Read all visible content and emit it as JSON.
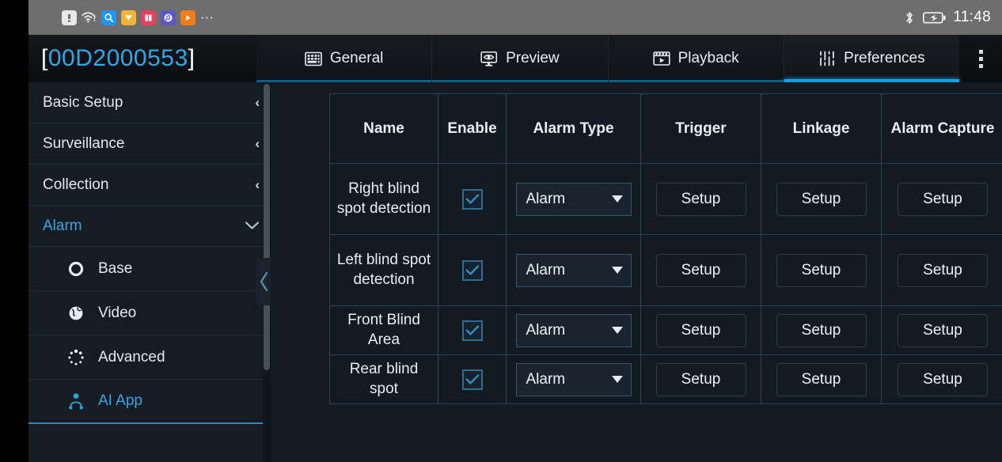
{
  "statusbar": {
    "icons": [
      {
        "name": "alert-icon",
        "color": "#e8e8e8"
      },
      {
        "name": "wifi-alert-icon",
        "color": "#e8e8e8"
      },
      {
        "name": "search-icon",
        "color": "#2196f3"
      },
      {
        "name": "shield-heart-icon",
        "color": "#f5b335"
      },
      {
        "name": "book-icon",
        "color": "#e8415c"
      },
      {
        "name": "music-icon",
        "color": "#5b57c9"
      },
      {
        "name": "video-play-icon",
        "color": "#f07d1a"
      },
      {
        "name": "more-icon",
        "color": "#e8e8e8"
      }
    ],
    "overflow_label": "⋯",
    "bluetooth_icon": "bluetooth-icon",
    "battery_icon": "battery-charging-icon",
    "time": "11:48"
  },
  "header": {
    "device_id": "00D2000553",
    "bracket_open": "[",
    "bracket_close": "]",
    "tabs": [
      {
        "label": "General",
        "icon": "keypad-grid-icon",
        "active": false
      },
      {
        "label": "Preview",
        "icon": "monitor-eye-icon",
        "active": false
      },
      {
        "label": "Playback",
        "icon": "film-play-icon",
        "active": false
      },
      {
        "label": "Preferences",
        "icon": "sliders-icon",
        "active": true
      }
    ],
    "menu_icon": "kebab-menu-icon"
  },
  "sidebar": {
    "items": [
      {
        "label": "Basic Setup",
        "chevron": "‹",
        "state": "collapsed"
      },
      {
        "label": "Surveillance",
        "chevron": "‹",
        "state": "collapsed"
      },
      {
        "label": "Collection",
        "chevron": "‹",
        "state": "collapsed"
      },
      {
        "label": "Alarm",
        "chevron": "⌄",
        "state": "expanded"
      }
    ],
    "sub_items": [
      {
        "label": "Base",
        "icon": "ring-circle-icon",
        "selected": false
      },
      {
        "label": "Video",
        "icon": "globe-icon",
        "selected": false
      },
      {
        "label": "Advanced",
        "icon": "dotted-circle-icon",
        "selected": false
      },
      {
        "label": "AI App",
        "icon": "ai-person-icon",
        "selected": true
      }
    ],
    "collapse_chevron": "‹"
  },
  "table": {
    "headers": [
      "Name",
      "Enable",
      "Alarm Type",
      "Trigger",
      "Linkage",
      "Alarm Capture"
    ],
    "rows": [
      {
        "name": "Right blind spot detection",
        "enabled": true,
        "alarm_type": "Alarm",
        "trigger": "Setup",
        "linkage": "Setup",
        "alarm_capture": "Setup"
      },
      {
        "name": "Left blind spot detection",
        "enabled": true,
        "alarm_type": "Alarm",
        "trigger": "Setup",
        "linkage": "Setup",
        "alarm_capture": "Setup"
      },
      {
        "name": "Front Blind Area",
        "enabled": true,
        "alarm_type": "Alarm",
        "trigger": "Setup",
        "linkage": "Setup",
        "alarm_capture": "Setup"
      },
      {
        "name": "Rear blind spot",
        "enabled": true,
        "alarm_type": "Alarm",
        "trigger": "Setup",
        "linkage": "Setup",
        "alarm_capture": "Setup"
      }
    ]
  },
  "colors": {
    "accent": "#1a9fe0",
    "accent_text": "#3aa5e0",
    "grid_line": "#2c4354",
    "panel_bg": "#141a21",
    "sidebar_bg": "#151c24",
    "statusbar_bg": "#6e6e6e"
  }
}
